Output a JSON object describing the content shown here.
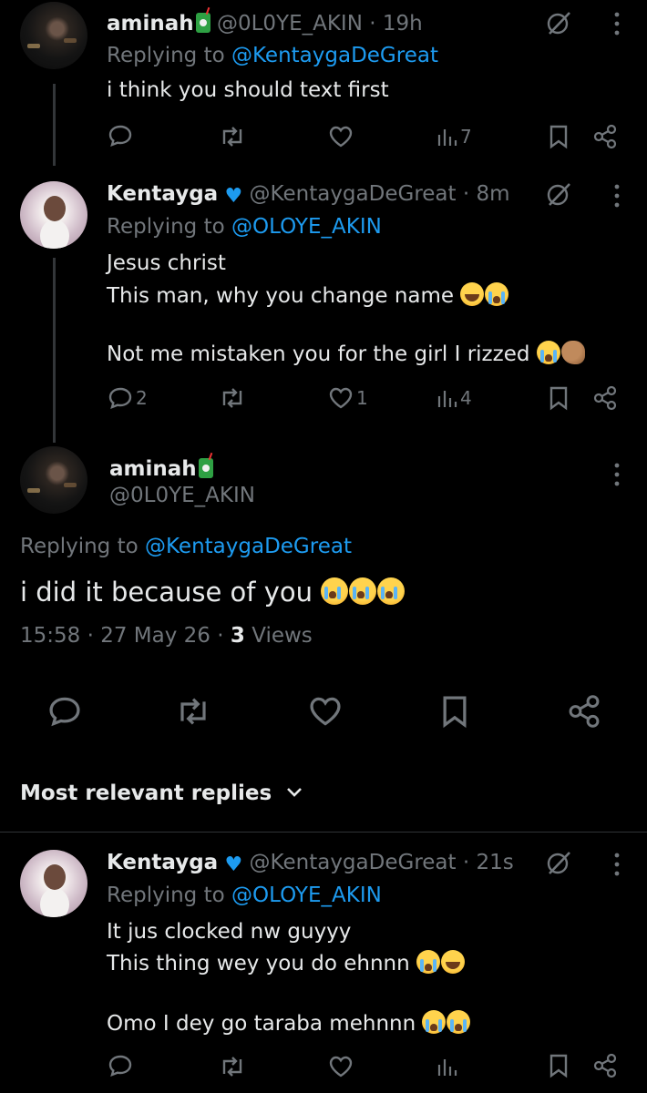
{
  "tweet1": {
    "name": "aminah",
    "handle": "@0L0YE_AKIN",
    "time": "19h",
    "replying_label": "Replying to",
    "replying_to": "@KentaygaDeGreat",
    "text": "i think you should text first",
    "views": "7"
  },
  "tweet2": {
    "name": "Kentayga",
    "handle": "@KentaygaDeGreat",
    "time": "8m",
    "replying_label": "Replying to",
    "replying_to": "@OLOYE_AKIN",
    "line1": "Jesus christ",
    "line2": "This man, why you change name",
    "line3": "Not me mistaken you for the girl I rizzed",
    "replies": "2",
    "likes": "1",
    "views": "4"
  },
  "main": {
    "name": "aminah",
    "handle": "@0L0YE_AKIN",
    "replying_label": "Replying to",
    "replying_to": "@KentaygaDeGreat",
    "text": "i did it because of you",
    "time": "15:58",
    "date": "27 May 26",
    "views_count": "3",
    "views_label": "Views"
  },
  "replies_header": {
    "label": "Most relevant replies"
  },
  "tweet3": {
    "name": "Kentayga",
    "handle": "@KentaygaDeGreat",
    "time": "21s",
    "replying_label": "Replying to",
    "replying_to": "@OLOYE_AKIN",
    "line1": "It jus clocked nw guyyy",
    "line2": "This thing wey you do ehnnn",
    "line3": "Omo I dey go taraba mehnnn"
  },
  "separator": "·",
  "colors": {
    "link": "#1d9bf0",
    "muted": "#71767b",
    "text": "#e7e9ea",
    "verified": "#1d9bf0"
  },
  "icons": [
    "reply-icon",
    "retweet-icon",
    "like-icon",
    "views-icon",
    "bookmark-icon",
    "share-icon",
    "grok-icon",
    "more-icon"
  ]
}
